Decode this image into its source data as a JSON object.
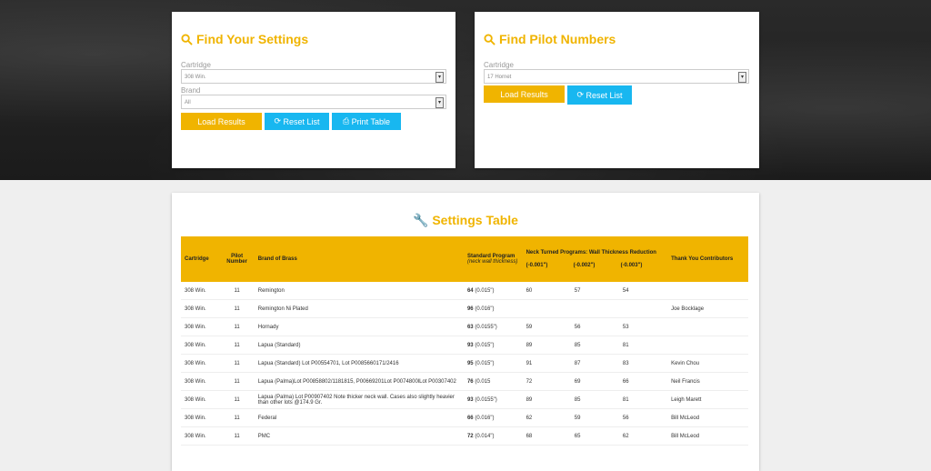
{
  "find_settings": {
    "title": "Find Your Settings",
    "cartridge_label": "Cartridge",
    "cartridge_value": "308 Win.",
    "brand_label": "Brand",
    "brand_value": "All",
    "load_results": "Load Results",
    "reset_list": "Reset List",
    "print_table": "Print Table"
  },
  "find_pilot": {
    "title": "Find Pilot Numbers",
    "cartridge_label": "Cartridge",
    "cartridge_value": "17 Hornet",
    "load_results": "Load Results",
    "reset_list": "Reset List"
  },
  "settings_table": {
    "title": "Settings Table",
    "headers": {
      "cartridge": "Cartridge",
      "pilot": "Pilot Number",
      "brand": "Brand of Brass",
      "standard": "Standard Program",
      "standard_note": "(neck wall thickness)",
      "neck": "Neck Turned Programs: Wall Thickness Reduction",
      "neck_a": "(-0.001\")",
      "neck_b": "(-0.002\")",
      "neck_c": "(-0.003\")",
      "thanks": "Thank You Contributors"
    },
    "rows": [
      {
        "cartridge": "308 Win.",
        "pilot": "11",
        "brand": "Remington",
        "std_num": "64",
        "std_val": "(0.015\")",
        "a": "60",
        "b": "57",
        "c": "54",
        "contrib": ""
      },
      {
        "cartridge": "308 Win.",
        "pilot": "11",
        "brand": "Remington Ni Plated",
        "std_num": "96",
        "std_val": "(0.016\")",
        "a": "",
        "b": "",
        "c": "",
        "contrib": "Joe Bocklage"
      },
      {
        "cartridge": "308 Win.",
        "pilot": "11",
        "brand": "Hornady",
        "std_num": "63",
        "std_val": "(0.0155\")",
        "a": "59",
        "b": "56",
        "c": "53",
        "contrib": ""
      },
      {
        "cartridge": "308 Win.",
        "pilot": "11",
        "brand": "Lapua (Standard)",
        "std_num": "93",
        "std_val": "(0.015\")",
        "a": "89",
        "b": "85",
        "c": "81",
        "contrib": ""
      },
      {
        "cartridge": "308 Win.",
        "pilot": "11",
        "brand": "Lapua (Standard) Lot P00554701, Lot P0085660171/2416",
        "std_num": "95",
        "std_val": "(0.015\")",
        "a": "91",
        "b": "87",
        "c": "83",
        "contrib": "Kevin Chou"
      },
      {
        "cartridge": "308 Win.",
        "pilot": "11",
        "brand": "Lapua (Palma)Lot P00858802/1181815, P00669201Lot P0074800lLot P00307402",
        "std_num": "76",
        "std_val": "(0.015",
        "a": "72",
        "b": "69",
        "c": "66",
        "contrib": "Neil Francis"
      },
      {
        "cartridge": "308 Win.",
        "pilot": "11",
        "brand": "Lapua (Palma) Lot P00907402 Note thicker neck wall. Cases also slightly heavier than other lots @174.9 Gr.",
        "std_num": "93",
        "std_val": "(0.0155\")",
        "a": "89",
        "b": "85",
        "c": "81",
        "contrib": "Leigh Marett"
      },
      {
        "cartridge": "308 Win.",
        "pilot": "11",
        "brand": "Federal",
        "std_num": "66",
        "std_val": "(0.016\")",
        "a": "62",
        "b": "59",
        "c": "56",
        "contrib": "Bill McLeod"
      },
      {
        "cartridge": "308 Win.",
        "pilot": "11",
        "brand": "PMC",
        "std_num": "72",
        "std_val": "(0.014\")",
        "a": "68",
        "b": "65",
        "c": "62",
        "contrib": "Bill McLeod"
      }
    ]
  },
  "colors": {
    "accent": "#f0b400",
    "button_blue": "#18b7f0"
  }
}
